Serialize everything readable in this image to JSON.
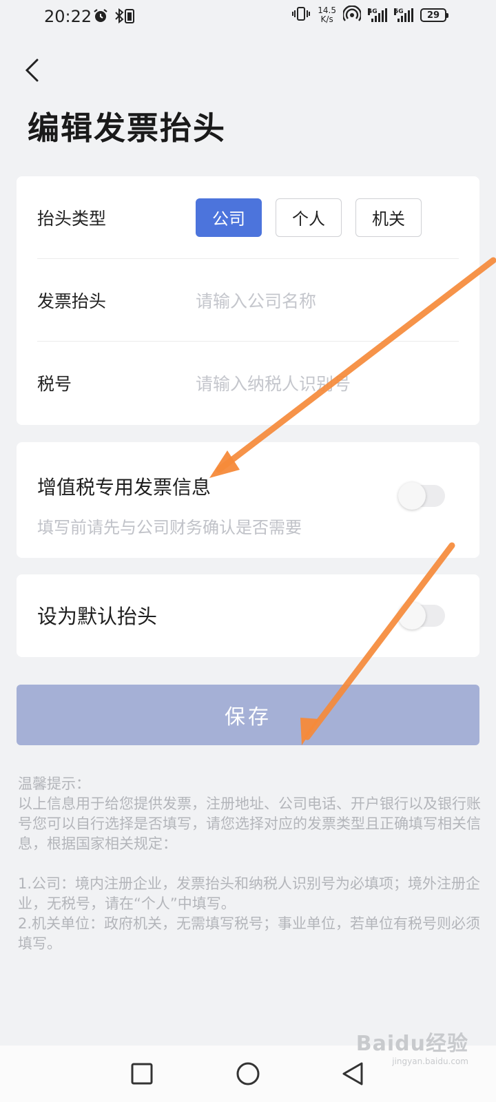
{
  "status_bar": {
    "time": "20:22",
    "net_speed_value": "14.5",
    "net_speed_unit": "K/s",
    "sig1_label": "4G",
    "sig2_label": "5G",
    "battery": "29"
  },
  "page": {
    "title": "编辑发票抬头"
  },
  "form": {
    "type_label": "抬头类型",
    "types": [
      "公司",
      "个人",
      "机关"
    ],
    "selected_type": "公司",
    "invoice_title_label": "发票抬头",
    "invoice_title_placeholder": "请输入公司名称",
    "tax_id_label": "税号",
    "tax_id_placeholder": "请输入纳税人识别号"
  },
  "vat": {
    "title": "增值税专用发票信息",
    "subtitle": "填写前请先与公司财务确认是否需要",
    "enabled": false
  },
  "default_header": {
    "label": "设为默认抬头",
    "enabled": false
  },
  "save_label": "保存",
  "tips": {
    "heading": "温馨提示：",
    "body": "以上信息用于给您提供发票，注册地址、公司电话、开户银行以及银行账号您可以自行选择是否填写，请您选择对应的发票类型且正确填写相关信息，根据国家相关规定：",
    "rule1": "1.公司：境内注册企业，发票抬头和纳税人识别号为必填项；境外注册企业，无税号，请在“个人”中填写。",
    "rule2": "2.机关单位：政府机关，无需填写税号；事业单位，若单位有税号则必须填写。"
  },
  "watermark": {
    "brand": "Baidu经验",
    "url": "jingyan.baidu.com"
  },
  "colors": {
    "accent": "#4c74dc",
    "save_disabled": "#a5b0d6",
    "arrow": "#f58a3a"
  }
}
